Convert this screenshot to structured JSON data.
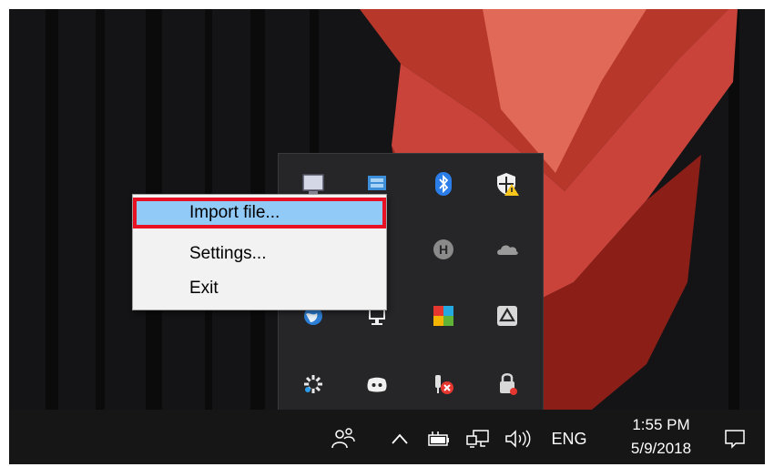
{
  "context_menu": {
    "items": [
      {
        "label": "Import file...",
        "highlighted": true
      },
      {
        "label": "Settings..."
      },
      {
        "label": "Exit"
      }
    ]
  },
  "tray_overflow": {
    "icons": [
      "monitor-app-icon",
      "network-app-icon",
      "bluetooth-icon",
      "windows-defender-warning-icon",
      "network-app-icon-2",
      "hotspot-shield-icon",
      "onedrive-icon",
      "globe-app-icon",
      "display-icon",
      "app-grid-icon",
      "google-drive-icon",
      "settings-gear-icon",
      "discord-icon",
      "usb-device-error-icon",
      "lock-app-icon"
    ]
  },
  "taskbar": {
    "people_icon": "people-icon",
    "show_hidden_icon": "chevron-up-icon",
    "battery_icon": "battery-icon",
    "network_icon": "network-icon",
    "volume_icon": "volume-icon",
    "language": "ENG",
    "time": "1:55 PM",
    "date": "5/9/2018",
    "notifications_icon": "action-center-icon"
  },
  "colors": {
    "menu_highlight": "#91c9f7",
    "highlight_border": "#e81123",
    "taskbar": "#161616",
    "flyout": "#262628"
  }
}
